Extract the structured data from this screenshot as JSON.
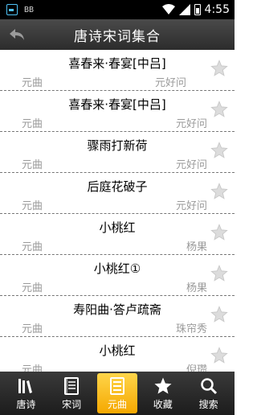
{
  "status_bar": {
    "time": "4:55",
    "left_icon_text": "BB"
  },
  "header": {
    "title": "唐诗宋词集合",
    "back_icon": "back-arrow-icon"
  },
  "list_items": [
    {
      "title": "喜春来·春宴[中吕]",
      "genre": "元曲",
      "author": "元好问"
    },
    {
      "title": "喜春来·春宴[中吕]",
      "genre": "元曲",
      "author": "元好问"
    },
    {
      "title": "骤雨打新荷",
      "genre": "元曲",
      "author": "元好问"
    },
    {
      "title": "后庭花破子",
      "genre": "元曲",
      "author": "元好问"
    },
    {
      "title": "小桃红",
      "genre": "元曲",
      "author": "杨果"
    },
    {
      "title": "小桃红①",
      "genre": "元曲",
      "author": "杨果"
    },
    {
      "title": "寿阳曲·答卢疏斋",
      "genre": "元曲",
      "author": "珠帘秀"
    },
    {
      "title": "小桃红",
      "genre": "元曲",
      "author": "倪瓒"
    }
  ],
  "tabs": [
    {
      "label": "唐诗",
      "icon": "books-icon",
      "active": false
    },
    {
      "label": "宋词",
      "icon": "notebook-icon",
      "active": false
    },
    {
      "label": "元曲",
      "icon": "list-icon",
      "active": true
    },
    {
      "label": "收藏",
      "icon": "star-icon",
      "active": false
    },
    {
      "label": "搜索",
      "icon": "search-icon",
      "active": false
    }
  ],
  "colors": {
    "active_tab": "#f5a800",
    "header_bg": "#3a3a3a",
    "secondary_text": "#9a9a9a"
  }
}
